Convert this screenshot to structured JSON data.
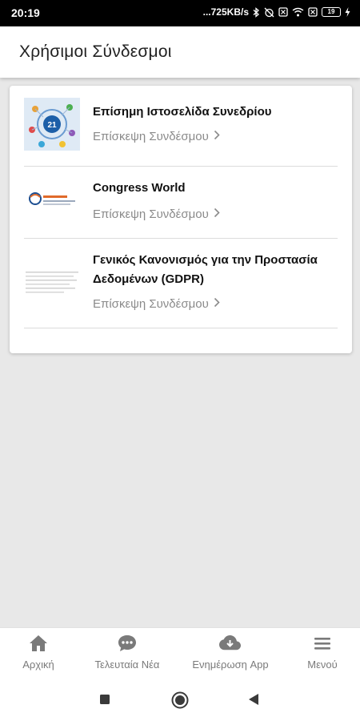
{
  "status_bar": {
    "time": "20:19",
    "network_speed": "...725KB/s",
    "battery": "19"
  },
  "app_bar": {
    "title": "Χρήσιμοι Σύνδεσμοι"
  },
  "links": [
    {
      "name": "Επίσημη Ιστοσελίδα Συνεδρίου",
      "action": "Επίσκεψη Συνδέσμου",
      "thumb_icon": "congress-logo-thumbnail"
    },
    {
      "name": "Congress World",
      "action": "Επίσκεψη Συνδέσμου",
      "thumb_icon": "congress-world-logo-thumbnail"
    },
    {
      "name": "Γενικός Κανονισμός για την Προστασία Δεδομένων (GDPR)",
      "action": "Επίσκεψη Συνδέσμου",
      "thumb_icon": "gdpr-document-thumbnail"
    }
  ],
  "bottom_nav": [
    {
      "label": "Αρχική",
      "icon": "home-icon"
    },
    {
      "label": "Τελευταία Νέα",
      "icon": "chat-icon"
    },
    {
      "label": "Ενημέρωση App",
      "icon": "cloud-download-icon"
    },
    {
      "label": "Μενού",
      "icon": "menu-icon"
    }
  ],
  "colors": {
    "background": "#e8e8e8",
    "nav_icon": "#7a7a7a",
    "link_title": "#111111",
    "link_action": "#8a8a8a"
  }
}
